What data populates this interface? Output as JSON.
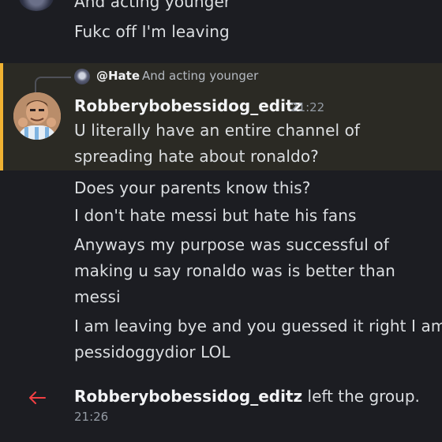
{
  "top_messages": [
    "And acting younger",
    "Fukc off I'm leaving"
  ],
  "reply": {
    "mention": "@Hate",
    "preview": "And acting younger"
  },
  "message": {
    "author": "Robberybobessidog_editz",
    "time": "21:22",
    "lines": [
      "U literally have an entire channel of",
      "spreading hate about ronaldo?",
      "Does your parents know this?",
      "I don't hate messi but hate his fans",
      "Anyways my purpose was successful of",
      "making u say ronaldo was is better than",
      "messi",
      "I am leaving bye and you guessed it right I am",
      "pessidoggydior LOL"
    ]
  },
  "system": {
    "user": "Robberybobessidog_editz",
    "action": "left the group.",
    "time": "21:26",
    "icon": "leave-arrow-icon",
    "icon_color": "#f23f43"
  },
  "colors": {
    "background": "#1c1d22",
    "highlight": "#2b2a24",
    "mention_bar": "#f0b232"
  }
}
